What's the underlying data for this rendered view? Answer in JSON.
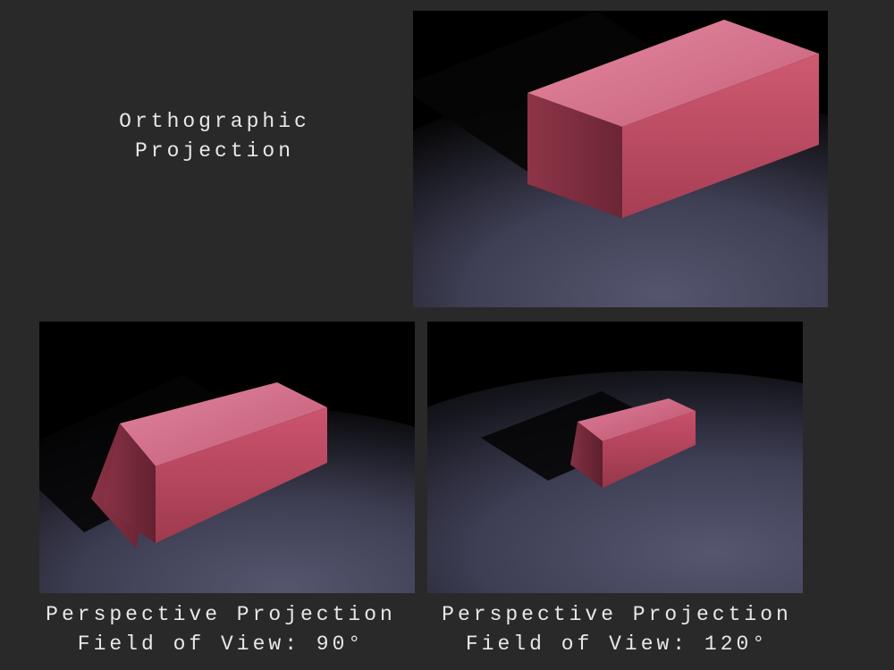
{
  "labels": {
    "orthographic": "Orthographic\nProjection",
    "perspective90": "Perspective Projection\nField of View: 90°",
    "perspective120": "Perspective Projection\nField of View: 120°"
  },
  "panels": {
    "orthographic": {
      "projection": "orthographic",
      "fov_deg": null,
      "subject": "red-cube",
      "cube_color": "#c24b62"
    },
    "perspective_90": {
      "projection": "perspective",
      "fov_deg": 90,
      "subject": "red-cube",
      "cube_color": "#c24b62"
    },
    "perspective_120": {
      "projection": "perspective",
      "fov_deg": 120,
      "subject": "red-cube",
      "cube_color": "#c24b62"
    }
  },
  "colors": {
    "background": "#292929",
    "floor_lit": "#4b4b62",
    "floor_dark": "#1a1a26",
    "cube_top": "#d46a82",
    "cube_front": "#c24b62",
    "cube_side": "#843245",
    "shadow": "#050508"
  }
}
